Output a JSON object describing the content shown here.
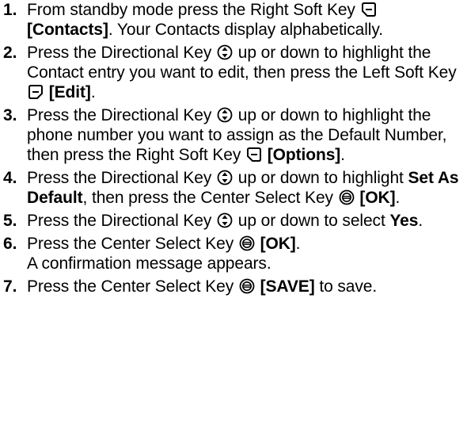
{
  "steps": [
    {
      "num": "1.",
      "a": "From standby mode press the Right Soft Key ",
      "b": "[Contacts]",
      "c": ". Your Contacts display alphabetically."
    },
    {
      "num": "2.",
      "a": "Press the Directional Key ",
      "b": " up or down to highlight the Contact entry you want to edit, then press the Left Soft Key ",
      "c": "[Edit]",
      "d": "."
    },
    {
      "num": "3.",
      "a": "Press the Directional Key ",
      "b": " up or down to highlight the phone number you want to assign as the Default Number, then press the Right Soft Key ",
      "c": "[Options]",
      "d": "."
    },
    {
      "num": "4.",
      "a": "Press the Directional Key ",
      "b": " up or down to highlight ",
      "c": "Set As Default",
      "d": ", then press the Center Select Key ",
      "e": "[OK]",
      "f": "."
    },
    {
      "num": "5.",
      "a": "Press the Directional Key ",
      "b": " up or down to select ",
      "c": "Yes",
      "d": "."
    },
    {
      "num": "6.",
      "a": "Press the Center Select Key ",
      "b": "[OK]",
      "c": ".",
      "d": "A confirmation message appears."
    },
    {
      "num": "7.",
      "a": "Press the Center Select Key ",
      "b": "[SAVE]",
      "c": " to save."
    }
  ]
}
